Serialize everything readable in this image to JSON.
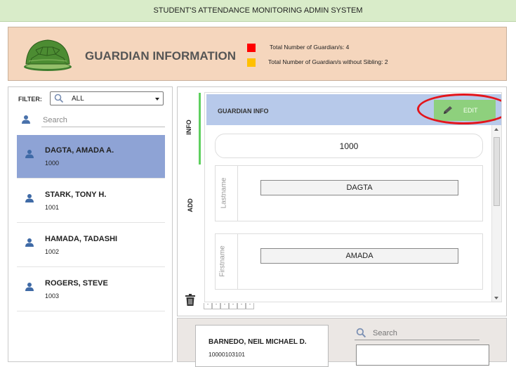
{
  "app": {
    "title": "STUDENT'S ATTENDANCE MONITORING ADMIN SYSTEM"
  },
  "header": {
    "title": "GUARDIAN INFORMATION",
    "logo_icon": "turtle-shell-icon",
    "stats": [
      {
        "label": "Total Number of Guardian/s: 4",
        "color": "#ff0000"
      },
      {
        "label": "Total Number of Guardian/s without Sibling: 2",
        "color": "#ffc000"
      }
    ]
  },
  "sidebar": {
    "filter_label": "FILTER:",
    "filter_value": "ALL",
    "search_placeholder": "Search",
    "guardians": [
      {
        "name": "DAGTA, AMADA A.",
        "id": "1000",
        "selected": true
      },
      {
        "name": "STARK, TONY H.",
        "id": "1001",
        "selected": false
      },
      {
        "name": "HAMADA, TADASHI",
        "id": "1002",
        "selected": false
      },
      {
        "name": "ROGERS, STEVE",
        "id": "1003",
        "selected": false
      }
    ]
  },
  "detail": {
    "tabs": [
      {
        "label": "INFO",
        "active": true
      },
      {
        "label": "ADD",
        "active": false
      }
    ],
    "section_title": "GUARDIAN INFO",
    "edit_label": "EDIT",
    "guardian_id": "1000",
    "fields": [
      {
        "label": "Lastname",
        "value": "DAGTA"
      },
      {
        "label": "Firstname",
        "value": "AMADA"
      }
    ],
    "pager": [
      "-",
      "-",
      "-",
      "-",
      "-",
      "-"
    ]
  },
  "students": {
    "search_placeholder": "Search",
    "items": [
      {
        "name": "BARNEDO, NEIL MICHAEL D.",
        "id": "10000103101"
      }
    ]
  },
  "colors": {
    "accent_green": "#8ed07d",
    "selected_row": "#8ea3d5",
    "header_bg": "#f5d6bd",
    "highlight_ring": "#e3151c"
  }
}
